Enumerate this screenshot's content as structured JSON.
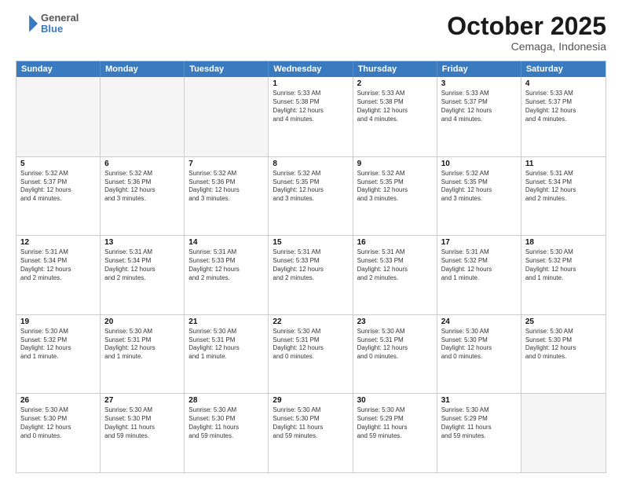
{
  "header": {
    "logo_line1": "General",
    "logo_line2": "Blue",
    "month_year": "October 2025",
    "location": "Cemaga, Indonesia"
  },
  "weekdays": [
    "Sunday",
    "Monday",
    "Tuesday",
    "Wednesday",
    "Thursday",
    "Friday",
    "Saturday"
  ],
  "rows": [
    [
      {
        "day": "",
        "text": "",
        "empty": true
      },
      {
        "day": "",
        "text": "",
        "empty": true
      },
      {
        "day": "",
        "text": "",
        "empty": true
      },
      {
        "day": "1",
        "text": "Sunrise: 5:33 AM\nSunset: 5:38 PM\nDaylight: 12 hours\nand 4 minutes.",
        "empty": false
      },
      {
        "day": "2",
        "text": "Sunrise: 5:33 AM\nSunset: 5:38 PM\nDaylight: 12 hours\nand 4 minutes.",
        "empty": false
      },
      {
        "day": "3",
        "text": "Sunrise: 5:33 AM\nSunset: 5:37 PM\nDaylight: 12 hours\nand 4 minutes.",
        "empty": false
      },
      {
        "day": "4",
        "text": "Sunrise: 5:33 AM\nSunset: 5:37 PM\nDaylight: 12 hours\nand 4 minutes.",
        "empty": false
      }
    ],
    [
      {
        "day": "5",
        "text": "Sunrise: 5:32 AM\nSunset: 5:37 PM\nDaylight: 12 hours\nand 4 minutes.",
        "empty": false
      },
      {
        "day": "6",
        "text": "Sunrise: 5:32 AM\nSunset: 5:36 PM\nDaylight: 12 hours\nand 3 minutes.",
        "empty": false
      },
      {
        "day": "7",
        "text": "Sunrise: 5:32 AM\nSunset: 5:36 PM\nDaylight: 12 hours\nand 3 minutes.",
        "empty": false
      },
      {
        "day": "8",
        "text": "Sunrise: 5:32 AM\nSunset: 5:35 PM\nDaylight: 12 hours\nand 3 minutes.",
        "empty": false
      },
      {
        "day": "9",
        "text": "Sunrise: 5:32 AM\nSunset: 5:35 PM\nDaylight: 12 hours\nand 3 minutes.",
        "empty": false
      },
      {
        "day": "10",
        "text": "Sunrise: 5:32 AM\nSunset: 5:35 PM\nDaylight: 12 hours\nand 3 minutes.",
        "empty": false
      },
      {
        "day": "11",
        "text": "Sunrise: 5:31 AM\nSunset: 5:34 PM\nDaylight: 12 hours\nand 2 minutes.",
        "empty": false
      }
    ],
    [
      {
        "day": "12",
        "text": "Sunrise: 5:31 AM\nSunset: 5:34 PM\nDaylight: 12 hours\nand 2 minutes.",
        "empty": false
      },
      {
        "day": "13",
        "text": "Sunrise: 5:31 AM\nSunset: 5:34 PM\nDaylight: 12 hours\nand 2 minutes.",
        "empty": false
      },
      {
        "day": "14",
        "text": "Sunrise: 5:31 AM\nSunset: 5:33 PM\nDaylight: 12 hours\nand 2 minutes.",
        "empty": false
      },
      {
        "day": "15",
        "text": "Sunrise: 5:31 AM\nSunset: 5:33 PM\nDaylight: 12 hours\nand 2 minutes.",
        "empty": false
      },
      {
        "day": "16",
        "text": "Sunrise: 5:31 AM\nSunset: 5:33 PM\nDaylight: 12 hours\nand 2 minutes.",
        "empty": false
      },
      {
        "day": "17",
        "text": "Sunrise: 5:31 AM\nSunset: 5:32 PM\nDaylight: 12 hours\nand 1 minute.",
        "empty": false
      },
      {
        "day": "18",
        "text": "Sunrise: 5:30 AM\nSunset: 5:32 PM\nDaylight: 12 hours\nand 1 minute.",
        "empty": false
      }
    ],
    [
      {
        "day": "19",
        "text": "Sunrise: 5:30 AM\nSunset: 5:32 PM\nDaylight: 12 hours\nand 1 minute.",
        "empty": false
      },
      {
        "day": "20",
        "text": "Sunrise: 5:30 AM\nSunset: 5:31 PM\nDaylight: 12 hours\nand 1 minute.",
        "empty": false
      },
      {
        "day": "21",
        "text": "Sunrise: 5:30 AM\nSunset: 5:31 PM\nDaylight: 12 hours\nand 1 minute.",
        "empty": false
      },
      {
        "day": "22",
        "text": "Sunrise: 5:30 AM\nSunset: 5:31 PM\nDaylight: 12 hours\nand 0 minutes.",
        "empty": false
      },
      {
        "day": "23",
        "text": "Sunrise: 5:30 AM\nSunset: 5:31 PM\nDaylight: 12 hours\nand 0 minutes.",
        "empty": false
      },
      {
        "day": "24",
        "text": "Sunrise: 5:30 AM\nSunset: 5:30 PM\nDaylight: 12 hours\nand 0 minutes.",
        "empty": false
      },
      {
        "day": "25",
        "text": "Sunrise: 5:30 AM\nSunset: 5:30 PM\nDaylight: 12 hours\nand 0 minutes.",
        "empty": false
      }
    ],
    [
      {
        "day": "26",
        "text": "Sunrise: 5:30 AM\nSunset: 5:30 PM\nDaylight: 12 hours\nand 0 minutes.",
        "empty": false
      },
      {
        "day": "27",
        "text": "Sunrise: 5:30 AM\nSunset: 5:30 PM\nDaylight: 11 hours\nand 59 minutes.",
        "empty": false
      },
      {
        "day": "28",
        "text": "Sunrise: 5:30 AM\nSunset: 5:30 PM\nDaylight: 11 hours\nand 59 minutes.",
        "empty": false
      },
      {
        "day": "29",
        "text": "Sunrise: 5:30 AM\nSunset: 5:30 PM\nDaylight: 11 hours\nand 59 minutes.",
        "empty": false
      },
      {
        "day": "30",
        "text": "Sunrise: 5:30 AM\nSunset: 5:29 PM\nDaylight: 11 hours\nand 59 minutes.",
        "empty": false
      },
      {
        "day": "31",
        "text": "Sunrise: 5:30 AM\nSunset: 5:29 PM\nDaylight: 11 hours\nand 59 minutes.",
        "empty": false
      },
      {
        "day": "",
        "text": "",
        "empty": true
      }
    ]
  ]
}
